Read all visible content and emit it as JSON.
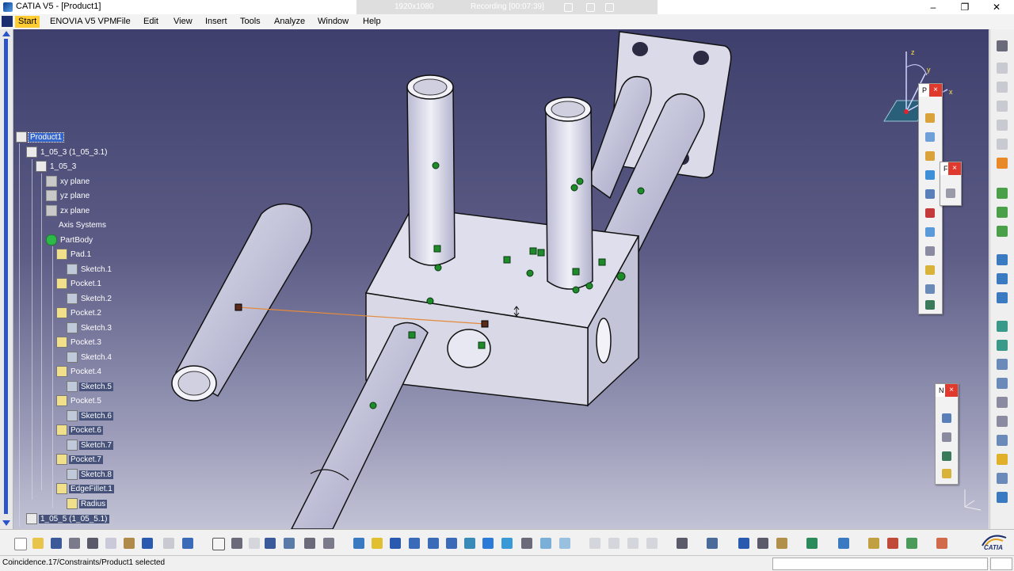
{
  "window": {
    "title": "CATIA V5 - [Product1]",
    "recording": {
      "resolution": "1920x1080",
      "status": "Recording [00:07:39]"
    },
    "controls": {
      "minimize": "–",
      "maximize": "❐",
      "close": "✕"
    }
  },
  "menubar": {
    "items": [
      "Start",
      "ENOVIA V5 VPM",
      "File",
      "Edit",
      "View",
      "Insert",
      "Tools",
      "Analyze",
      "Window",
      "Help"
    ]
  },
  "tree": {
    "nodes": [
      {
        "label": "Product1",
        "icon": "product-icon",
        "state": "selected"
      },
      {
        "label": "1_05_3 (1_05_3.1)",
        "icon": "component-icon"
      },
      {
        "label": "1_05_3",
        "icon": "part-icon"
      },
      {
        "label": "xy plane",
        "icon": "plane-icon"
      },
      {
        "label": "yz plane",
        "icon": "plane-icon"
      },
      {
        "label": "zx plane",
        "icon": "plane-icon"
      },
      {
        "label": "Axis Systems",
        "icon": "axis-icon"
      },
      {
        "label": "PartBody",
        "icon": "body-icon"
      },
      {
        "label": "Pad.1",
        "icon": "feature-icon"
      },
      {
        "label": "Sketch.1",
        "icon": "sketch-icon"
      },
      {
        "label": "Pocket.1",
        "icon": "feature-icon"
      },
      {
        "label": "Sketch.2",
        "icon": "sketch-icon"
      },
      {
        "label": "Pocket.2",
        "icon": "feature-icon"
      },
      {
        "label": "Sketch.3",
        "icon": "sketch-icon"
      },
      {
        "label": "Pocket.3",
        "icon": "feature-icon"
      },
      {
        "label": "Sketch.4",
        "icon": "sketch-icon"
      },
      {
        "label": "Pocket.4",
        "icon": "feature-icon"
      },
      {
        "label": "Sketch.5",
        "icon": "sketch-icon",
        "state": "highlighted"
      },
      {
        "label": "Pocket.5",
        "icon": "feature-icon"
      },
      {
        "label": "Sketch.6",
        "icon": "sketch-icon",
        "state": "highlighted"
      },
      {
        "label": "Pocket.6",
        "icon": "feature-icon",
        "state": "highlighted"
      },
      {
        "label": "Sketch.7",
        "icon": "sketch-icon",
        "state": "highlighted"
      },
      {
        "label": "Pocket.7",
        "icon": "feature-icon",
        "state": "highlighted"
      },
      {
        "label": "Sketch.8",
        "icon": "sketch-icon",
        "state": "highlighted"
      },
      {
        "label": "EdgeFillet.1",
        "icon": "fillet-icon",
        "state": "highlighted"
      },
      {
        "label": "Radius",
        "icon": "parameter-icon",
        "state": "highlighted"
      },
      {
        "label": "1_05_5 (1_05_5.1)",
        "icon": "component-icon",
        "state": "highlighted"
      }
    ]
  },
  "compass": {
    "x": "x",
    "y": "y",
    "z": "z"
  },
  "floating_toolbars": [
    {
      "title": "P",
      "close": "×"
    },
    {
      "title": "F",
      "close": "×"
    },
    {
      "title": "N",
      "close": "×"
    }
  ],
  "colors": {
    "background_top": "#3f3f6d",
    "background_bottom": "#c3c3d6",
    "part": "#d9d9e8",
    "constraint_green": "#1f8a2a",
    "selection_blue": "#3464c8",
    "close_red": "#e03a2f"
  },
  "statusbar": {
    "text": "Coincidence.17/Constraints/Product1 selected"
  },
  "brand": {
    "logo_text": "CATIA"
  }
}
